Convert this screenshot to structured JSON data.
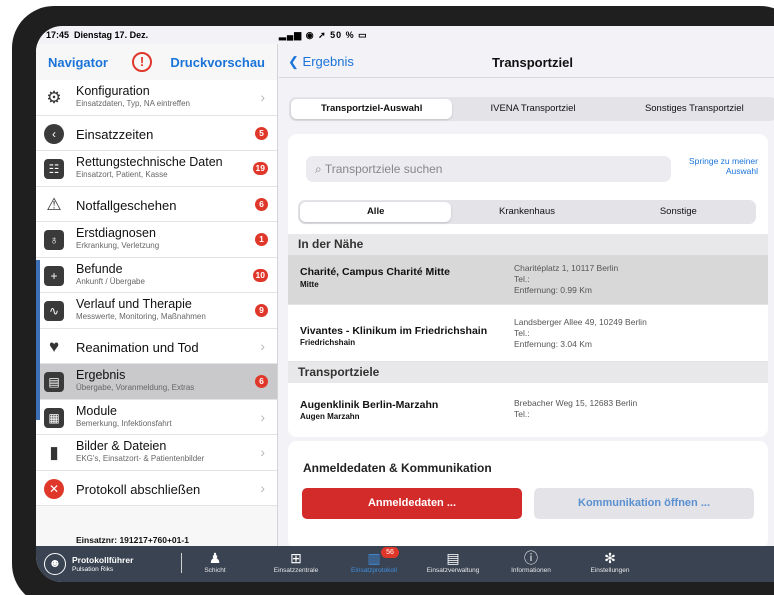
{
  "status": {
    "time": "17:45",
    "date": "Dienstag 17. Dez.",
    "battery": "50 %"
  },
  "left": {
    "nav_left": "Navigator",
    "warn_icon": "!",
    "nav_right": "Druckvorschau",
    "items": [
      {
        "title": "Konfiguration",
        "sub": "Einsatzdaten, Typ, NA eintreffen",
        "badge": "",
        "icon": "gears-icon"
      },
      {
        "title": "Einsatzzeiten",
        "sub": "",
        "badge": "5",
        "icon": "clock-icon"
      },
      {
        "title": "Rettungstechnische Daten",
        "sub": "Einsatzort, Patient, Kasse",
        "badge": "19",
        "icon": "table-icon"
      },
      {
        "title": "Notfallgeschehen",
        "sub": "",
        "badge": "6",
        "icon": "alert-scene-icon"
      },
      {
        "title": "Erstdiagnosen",
        "sub": "Erkrankung, Verletzung",
        "badge": "1",
        "icon": "stethoscope-icon"
      },
      {
        "title": "Befunde",
        "sub": "Ankunft / Übergabe",
        "badge": "10",
        "icon": "plus-icon"
      },
      {
        "title": "Verlauf und Therapie",
        "sub": "Messwerte, Monitoring, Maßnahmen",
        "badge": "9",
        "icon": "pulse-icon"
      },
      {
        "title": "Reanimation und Tod",
        "sub": "",
        "badge": "",
        "icon": "heart-icon"
      },
      {
        "title": "Ergebnis",
        "sub": "Übergabe, Voranmeldung, Extras",
        "badge": "6",
        "icon": "clipboard-icon"
      },
      {
        "title": "Module",
        "sub": "Bemerkung, Infektionsfahrt",
        "badge": "",
        "icon": "grid-icon"
      },
      {
        "title": "Bilder & Dateien",
        "sub": "EKG's, Einsatzort- & Patientenbilder",
        "badge": "",
        "icon": "file-icon"
      },
      {
        "title": "Protokoll abschließen",
        "sub": "",
        "badge": "",
        "icon": "close-circle-icon"
      }
    ],
    "einsatznr": "Einsatznr: 191217+760+01-1"
  },
  "right": {
    "back": "Ergebnis",
    "title": "Transportziel",
    "tabs": [
      "Transportziel-Auswahl",
      "IVENA Transportziel",
      "Sonstiges Transportziel"
    ],
    "search_placeholder": "Transportziele suchen",
    "springe": "Springe zu meiner Auswahl",
    "filters": [
      "Alle",
      "Krankenhaus",
      "Sonstige"
    ],
    "section_near": "In der Nähe",
    "near": [
      {
        "name": "Charité, Campus Charité Mitte",
        "short": "Mitte",
        "address": "Charitéplatz 1, 10117 Berlin",
        "tel": "Tel.:",
        "distance": "Entfernung: 0.99 Km"
      },
      {
        "name": "Vivantes - Klinikum im Friedrichshain",
        "short": "Friedrichshain",
        "address": "Landsberger Allee 49, 10249 Berlin",
        "tel": "Tel.:",
        "distance": "Entfernung: 3.04 Km"
      }
    ],
    "section_targets": "Transportziele",
    "targets": [
      {
        "name": "Augenklinik Berlin-Marzahn",
        "short": "Augen Marzahn",
        "address": "Brebacher Weg 15, 12683 Berlin",
        "tel": "Tel.:"
      }
    ],
    "anmelde_header": "Anmeldedaten & Kommunikation",
    "btn_anmelde": "Anmeldedaten ...",
    "btn_komm": "Kommunikation öffnen ..."
  },
  "tabbar": {
    "user_name": "Protokollführer",
    "user_org": "Pulsation Riks",
    "tabs": [
      {
        "label": "Schicht",
        "icon": "person-icon",
        "badge": ""
      },
      {
        "label": "Einsatzzentrale",
        "icon": "medkit-icon",
        "badge": ""
      },
      {
        "label": "Einsatzprotokoll",
        "icon": "protocol-icon",
        "badge": "56"
      },
      {
        "label": "Einsatzverwaltung",
        "icon": "document-icon",
        "badge": ""
      },
      {
        "label": "Informationen",
        "icon": "info-icon",
        "badge": ""
      },
      {
        "label": "Einstellungen",
        "icon": "gear-icon",
        "badge": ""
      }
    ]
  },
  "colors": {
    "accent": "#1a73d9",
    "badge": "#e0372b",
    "primary_button": "#d32a2a",
    "tabbar": "#3a4352"
  }
}
